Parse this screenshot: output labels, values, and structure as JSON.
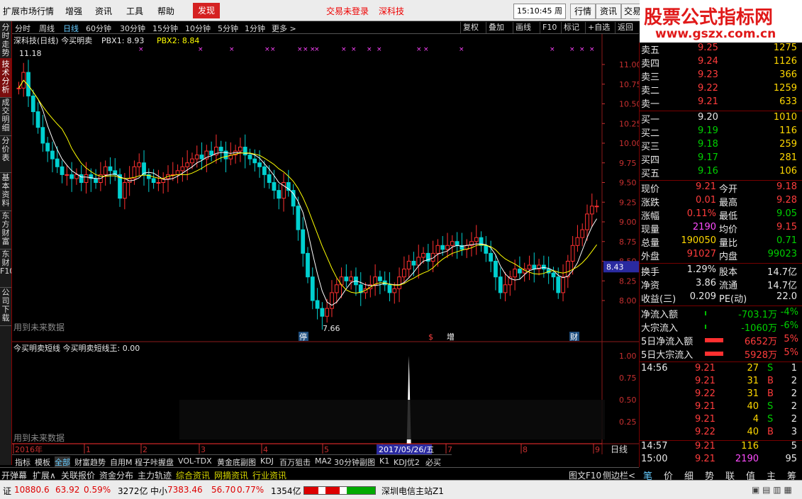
{
  "menubar": {
    "items": [
      "扩展市场行情",
      "增强",
      "资讯",
      "工具",
      "帮助"
    ],
    "fx_label": "发现",
    "notice1": "交易未登录",
    "notice2": "深科技",
    "time": "15:10:45 周六",
    "right_buttons": [
      "行情",
      "资讯",
      "交易"
    ]
  },
  "watermark": {
    "line1": "股票公式指标网",
    "line2": "www.gszx.com.cn"
  },
  "vtabs": [
    "分时走势",
    "技术分析",
    "成交明细",
    "分价表",
    "基本资料",
    "东方财富",
    "东财F10",
    "公司下载"
  ],
  "toolbar": {
    "periods": [
      "分时",
      "周线",
      "日线",
      "60分钟",
      "30分钟",
      "15分钟",
      "10分钟",
      "5分钟",
      "1分钟",
      "更多 >"
    ],
    "active_period": "日线",
    "right": [
      "复权",
      "叠加",
      "画线",
      "F10",
      "标记",
      "+自选",
      "返回"
    ]
  },
  "chart": {
    "main_title": "深科技(日线) 今买明卖",
    "pbx1_label": "PBX1: 8.93",
    "pbx2_label": "PBX2: 8.84",
    "high_label": "11.18",
    "low_label": "7.66",
    "future_note": "用到未来数据",
    "price_tag": "8.43",
    "markers": [
      "停",
      "$",
      "增",
      "财"
    ],
    "sub_title": "今买明卖短线 今买明卖短线王: 0.00",
    "date_label": "2017/05/26/五",
    "period_label": "日线",
    "colors": {
      "up": "#ff3030",
      "down": "#00d0d0",
      "ma1": "#ffffff",
      "ma2": "#ffff00",
      "axis": "#c83030"
    }
  },
  "chart_data": [
    {
      "type": "candlestick",
      "y_ticks": [
        11.0,
        10.75,
        10.5,
        10.25,
        10.0,
        9.75,
        9.5,
        9.25,
        9.0,
        8.75,
        8.5,
        8.25,
        8.0
      ],
      "ylim": [
        7.6,
        11.2
      ],
      "x_ticks": [
        "2016年",
        "1",
        "2",
        "3",
        "4",
        "5",
        "6",
        "7",
        "8",
        "9"
      ],
      "series": [
        {
          "name": "PBX1",
          "last": 8.93
        },
        {
          "name": "PBX2",
          "last": 8.84
        }
      ],
      "high": 11.18,
      "low": 7.66
    },
    {
      "type": "line",
      "title": "今买明卖短线",
      "y_ticks": [
        1.0,
        0.75,
        0.5,
        0.25
      ],
      "ylim": [
        0,
        1.05
      ],
      "series": [
        {
          "name": "今买明卖短线王",
          "last": 0.0
        }
      ]
    }
  ],
  "quote": {
    "sell": [
      {
        "label": "卖五",
        "price": "9.25",
        "vol": "1275"
      },
      {
        "label": "卖四",
        "price": "9.24",
        "vol": "1126"
      },
      {
        "label": "卖三",
        "price": "9.23",
        "vol": "366"
      },
      {
        "label": "卖二",
        "price": "9.22",
        "vol": "1259"
      },
      {
        "label": "卖一",
        "price": "9.21",
        "vol": "633"
      }
    ],
    "buy": [
      {
        "label": "买一",
        "price": "9.20",
        "vol": "1010"
      },
      {
        "label": "买二",
        "price": "9.19",
        "vol": "116"
      },
      {
        "label": "买三",
        "price": "9.18",
        "vol": "259"
      },
      {
        "label": "买四",
        "price": "9.17",
        "vol": "281"
      },
      {
        "label": "买五",
        "price": "9.16",
        "vol": "106"
      }
    ],
    "stats": [
      {
        "l1": "现价",
        "v1": "9.21",
        "l2": "今开",
        "v2": "9.18",
        "c1": "red",
        "c2": "red"
      },
      {
        "l1": "涨跌",
        "v1": "0.01",
        "l2": "最高",
        "v2": "9.28",
        "c1": "red",
        "c2": "red"
      },
      {
        "l1": "涨幅",
        "v1": "0.11%",
        "l2": "最低",
        "v2": "9.05",
        "c1": "red",
        "c2": "green"
      },
      {
        "l1": "现量",
        "v1": "2190",
        "l2": "均价",
        "v2": "9.15",
        "c1": "magenta",
        "c2": "red"
      },
      {
        "l1": "总量",
        "v1": "190050",
        "l2": "量比",
        "v2": "0.71",
        "c1": "yellow",
        "c2": "green"
      },
      {
        "l1": "外盘",
        "v1": "91027",
        "l2": "内盘",
        "v2": "99023",
        "c1": "red",
        "c2": "green"
      }
    ],
    "fund": [
      {
        "l1": "换手",
        "v1": "1.29%",
        "l2": "股本",
        "v2": "14.7亿"
      },
      {
        "l1": "净资",
        "v1": "3.86",
        "l2": "流通",
        "v2": "14.7亿"
      },
      {
        "l1": "收益(三)",
        "v1": "0.209",
        "l2": "PE(动)",
        "v2": "22.0"
      }
    ],
    "flows": [
      {
        "label": "净流入额",
        "value": "-703.1万",
        "pct": "-4%",
        "dir": "down"
      },
      {
        "label": "大宗流入",
        "value": "-1060万",
        "pct": "-6%",
        "dir": "down"
      },
      {
        "label": "5日净流入额",
        "value": "6652万",
        "pct": "5%",
        "dir": "up"
      },
      {
        "label": "5日大宗流入",
        "value": "5928万",
        "pct": "5%",
        "dir": "up"
      }
    ],
    "ticks": [
      {
        "time": "14:56",
        "price": "9.21",
        "vol": "27",
        "side": "S",
        "n": "1"
      },
      {
        "time": "",
        "price": "9.21",
        "vol": "31",
        "side": "B",
        "n": "2"
      },
      {
        "time": "",
        "price": "9.22",
        "vol": "31",
        "side": "B",
        "n": "2"
      },
      {
        "time": "",
        "price": "9.21",
        "vol": "40",
        "side": "S",
        "n": "2"
      },
      {
        "time": "",
        "price": "9.21",
        "vol": "4",
        "side": "S",
        "n": "2"
      },
      {
        "time": "",
        "price": "9.22",
        "vol": "40",
        "side": "B",
        "n": "3"
      },
      {
        "time": "14:57",
        "price": "9.21",
        "vol": "116",
        "side": "",
        "n": "5"
      },
      {
        "time": "15:00",
        "price": "9.21",
        "vol": "2190",
        "side": "",
        "n": "95"
      }
    ]
  },
  "bottom_tabs": [
    "指标",
    "模板",
    "全部",
    "财富趋势",
    "自用M",
    "程子咔握盘",
    "VOL-TDX",
    "黄金底副图",
    "KDJ",
    "百万狙击",
    "MA2",
    "30分钟副图",
    "K1",
    "KDJ优2",
    "必买"
  ],
  "bottom_active": "全部",
  "lower_bar": {
    "items": [
      "开弹幕",
      "扩展∧",
      "关联报价",
      "资金分布",
      "主力轨迹",
      "综合资讯",
      "网摘资讯",
      "行业资讯"
    ],
    "right": [
      "图文F10",
      "侧边栏<"
    ]
  },
  "right_icons": [
    "笔",
    "价",
    "细",
    "势",
    "联",
    "值",
    "主",
    "筹"
  ],
  "status": {
    "idx1_name": "证",
    "idx1_val": "10880.6",
    "idx1_chg": "63.92",
    "idx1_pct": "0.59%",
    "idx1_amt": "3272亿",
    "idx2_name": "中小",
    "idx2_val": "7383.46",
    "idx2_chg": "56.70",
    "idx2_pct": "0.77%",
    "idx2_amt": "1354亿",
    "server": "深圳电信主站Z1"
  }
}
